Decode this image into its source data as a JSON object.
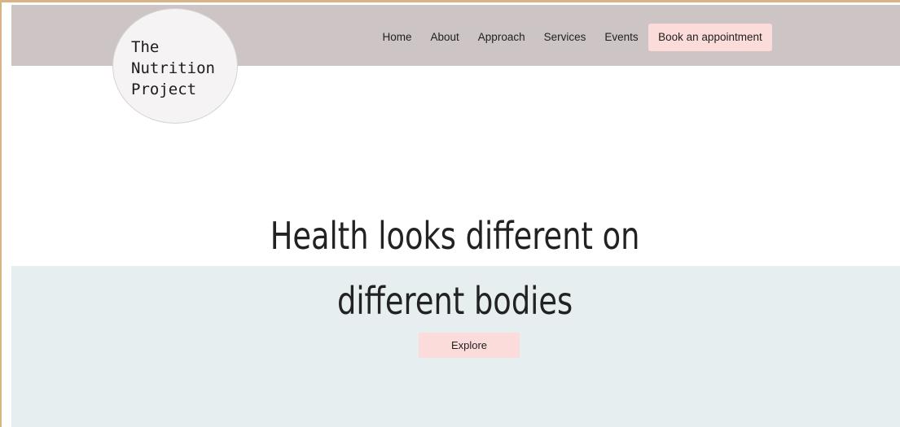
{
  "brand": {
    "logo_text": "The\nNutrition\nProject"
  },
  "nav": {
    "items": [
      "Home",
      "About",
      "Approach",
      "Services",
      "Events"
    ],
    "cta_label": "Book an appointment"
  },
  "hero": {
    "headline_line1": "Health looks different on",
    "headline_line2": "different bodies",
    "button_label": "Explore"
  },
  "colors": {
    "header_bg": "#cdc5c5",
    "hero_band_bg": "#e7eef0",
    "accent_button": "#fbdcdb",
    "frame_border": "#d9b384"
  }
}
